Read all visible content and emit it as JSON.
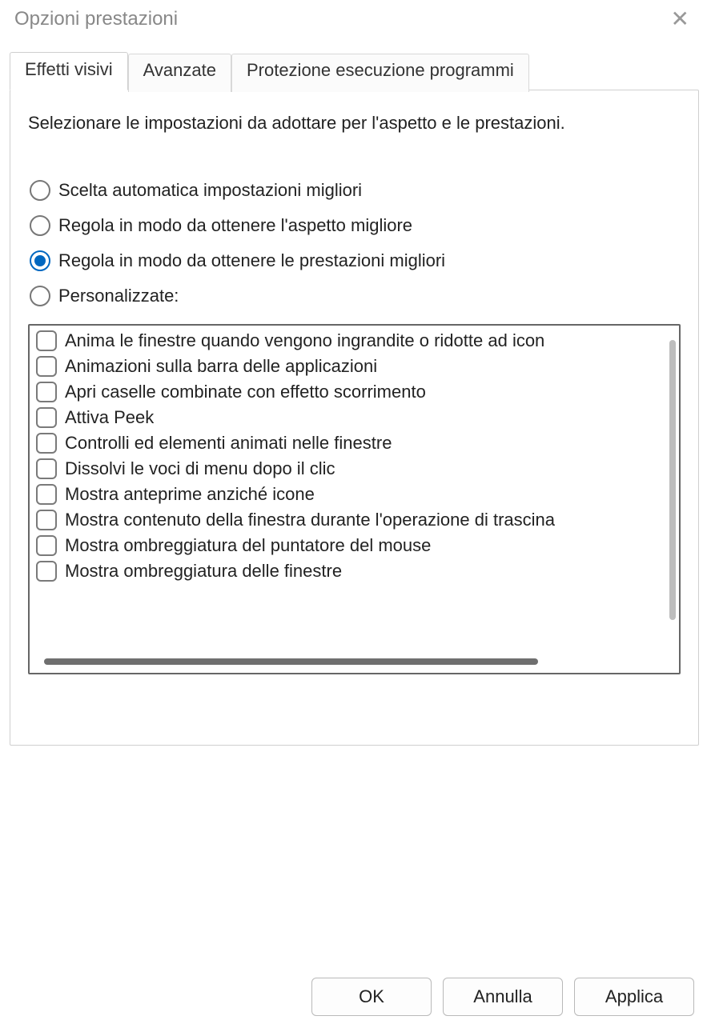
{
  "window": {
    "title": "Opzioni prestazioni"
  },
  "tabs": {
    "visual": "Effetti visivi",
    "advanced": "Avanzate",
    "dep": "Protezione esecuzione programmi"
  },
  "panel": {
    "instruction": "Selezionare le impostazioni da adottare per l'aspetto e le prestazioni."
  },
  "radios": {
    "auto": "Scelta automatica impostazioni migliori",
    "best_look": "Regola in modo da ottenere l'aspetto migliore",
    "best_perf": "Regola in modo da ottenere le prestazioni migliori",
    "custom": "Personalizzate:",
    "selected": "best_perf"
  },
  "options": [
    "Anima le finestre quando vengono ingrandite o ridotte ad icon",
    "Animazioni sulla barra delle applicazioni",
    "Apri caselle combinate con effetto scorrimento",
    "Attiva Peek",
    "Controlli ed elementi animati nelle finestre",
    "Dissolvi le voci di menu dopo il clic",
    "Mostra anteprime anziché icone",
    "Mostra contenuto della finestra durante l'operazione di trascina",
    "Mostra ombreggiatura del puntatore del mouse",
    "Mostra ombreggiatura delle finestre"
  ],
  "buttons": {
    "ok": "OK",
    "cancel": "Annulla",
    "apply": "Applica"
  }
}
